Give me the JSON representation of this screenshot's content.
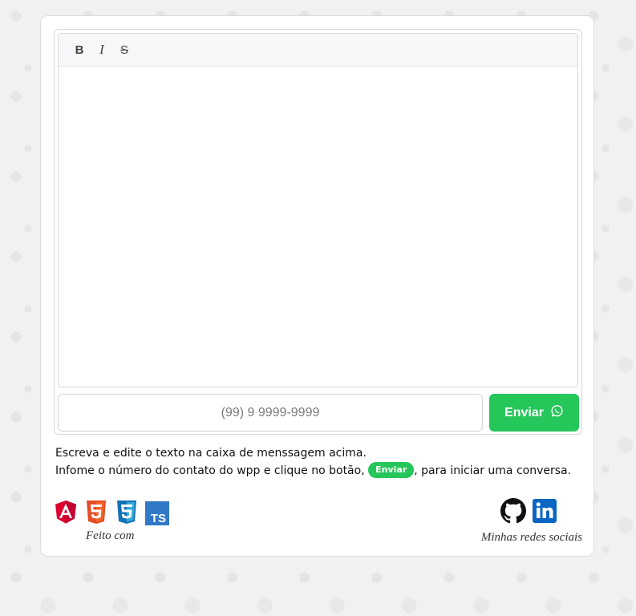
{
  "toolbar": {
    "bold_icon": "bold-icon",
    "bold_label": "B",
    "italic_icon": "italic-icon",
    "italic_label": "I",
    "strike_icon": "strikethrough-icon",
    "strike_label": "S"
  },
  "editor": {
    "content": ""
  },
  "phone": {
    "placeholder": "(99) 9 9999-9999",
    "value": ""
  },
  "send_button": {
    "label": "Enviar",
    "icon": "whatsapp-icon"
  },
  "instructions": {
    "line1": "Escreva e edite o texto na caixa de menssagem acima.",
    "line2_before": "Infome o número do contato do wpp e clique no botão, ",
    "inline_button": "Enviar",
    "line2_after": ", para iniciar uma conversa."
  },
  "tech": {
    "icons": [
      "angular-icon",
      "html5-icon",
      "css3-icon",
      "typescript-icon"
    ],
    "typescript_text": "TS",
    "label": "Feito com"
  },
  "social": {
    "icons": [
      "github-icon",
      "linkedin-icon"
    ],
    "label": "Minhas redes sociais"
  },
  "colors": {
    "accent_green": "#25c65a",
    "angular_red": "#dd0031",
    "html5_orange": "#e44d26",
    "css3_blue": "#1572b6",
    "typescript_blue": "#3178c6",
    "linkedin_blue": "#0a66c2"
  }
}
